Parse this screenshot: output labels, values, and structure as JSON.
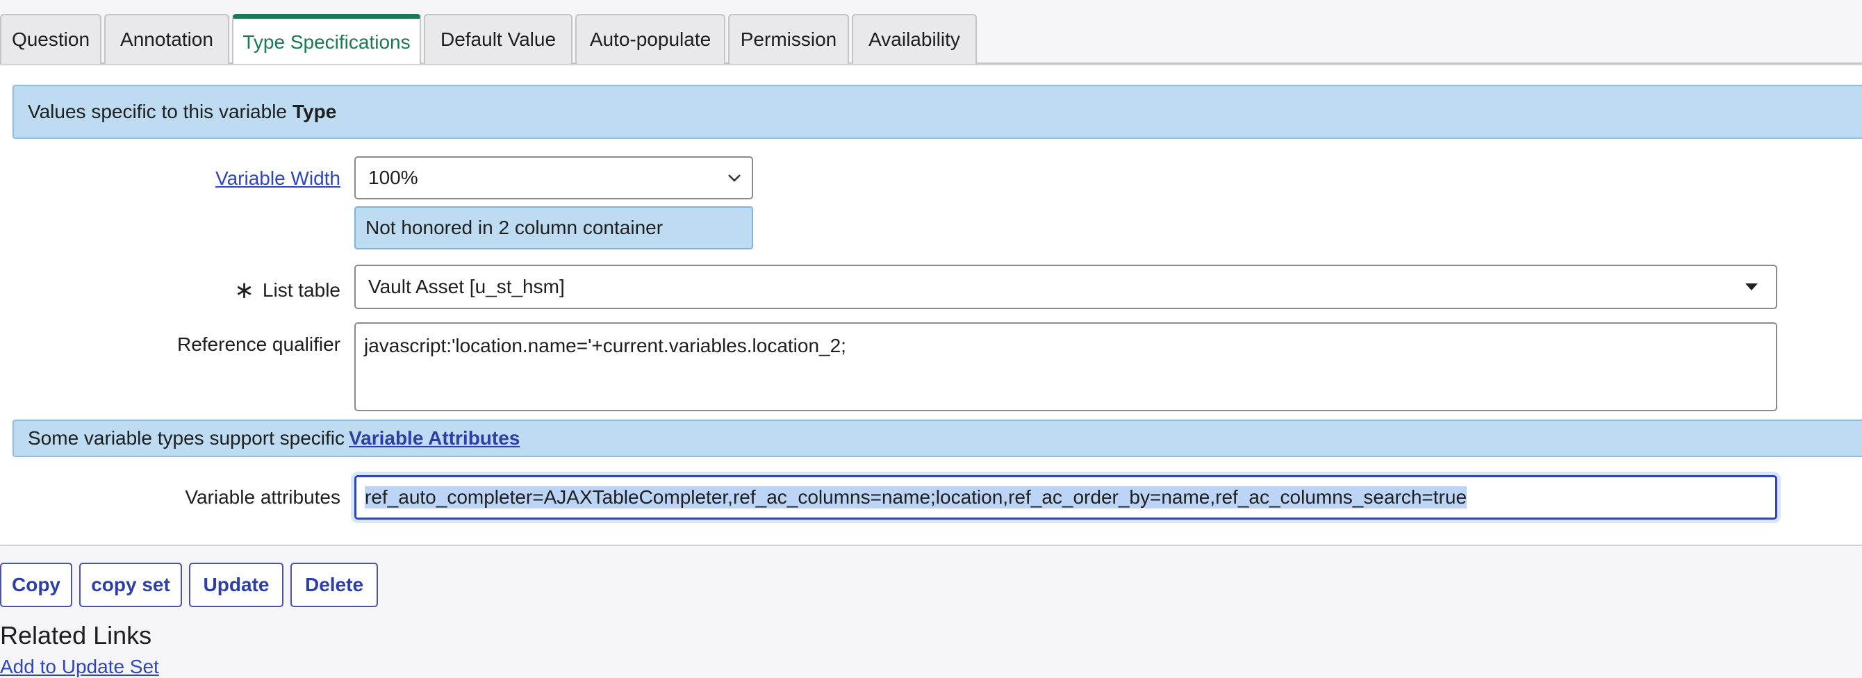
{
  "tabs": [
    {
      "label": "Question"
    },
    {
      "label": "Annotation"
    },
    {
      "label": "Type Specifications",
      "active": true
    },
    {
      "label": "Default Value"
    },
    {
      "label": "Auto-populate"
    },
    {
      "label": "Permission"
    },
    {
      "label": "Availability"
    }
  ],
  "type_banner": {
    "prefix": "Values specific to this variable",
    "bold": "Type"
  },
  "variable_width": {
    "label": "Variable Width",
    "value": "100%",
    "note": "Not honored in 2 column container"
  },
  "list_table": {
    "required_marker": "∗",
    "label": "List table",
    "value": "Vault Asset [u_st_hsm]"
  },
  "reference_qualifier": {
    "label": "Reference qualifier",
    "value": "javascript:'location.name='+current.variables.location_2;"
  },
  "attributes_banner": {
    "prefix": "Some variable types support specific",
    "link": "Variable Attributes"
  },
  "variable_attributes": {
    "label": "Variable attributes",
    "value": "ref_auto_completer=AJAXTableCompleter,ref_ac_columns=name;location,ref_ac_order_by=name,ref_ac_columns_search=true"
  },
  "buttons": {
    "copy": "Copy",
    "copy_set": "copy set",
    "update": "Update",
    "delete": "Delete"
  },
  "related": {
    "title": "Related Links",
    "link": "Add to Update Set"
  },
  "colors": {
    "accent": "#1a7a55",
    "banner": "#bddcf1",
    "link": "#2d46b9"
  }
}
